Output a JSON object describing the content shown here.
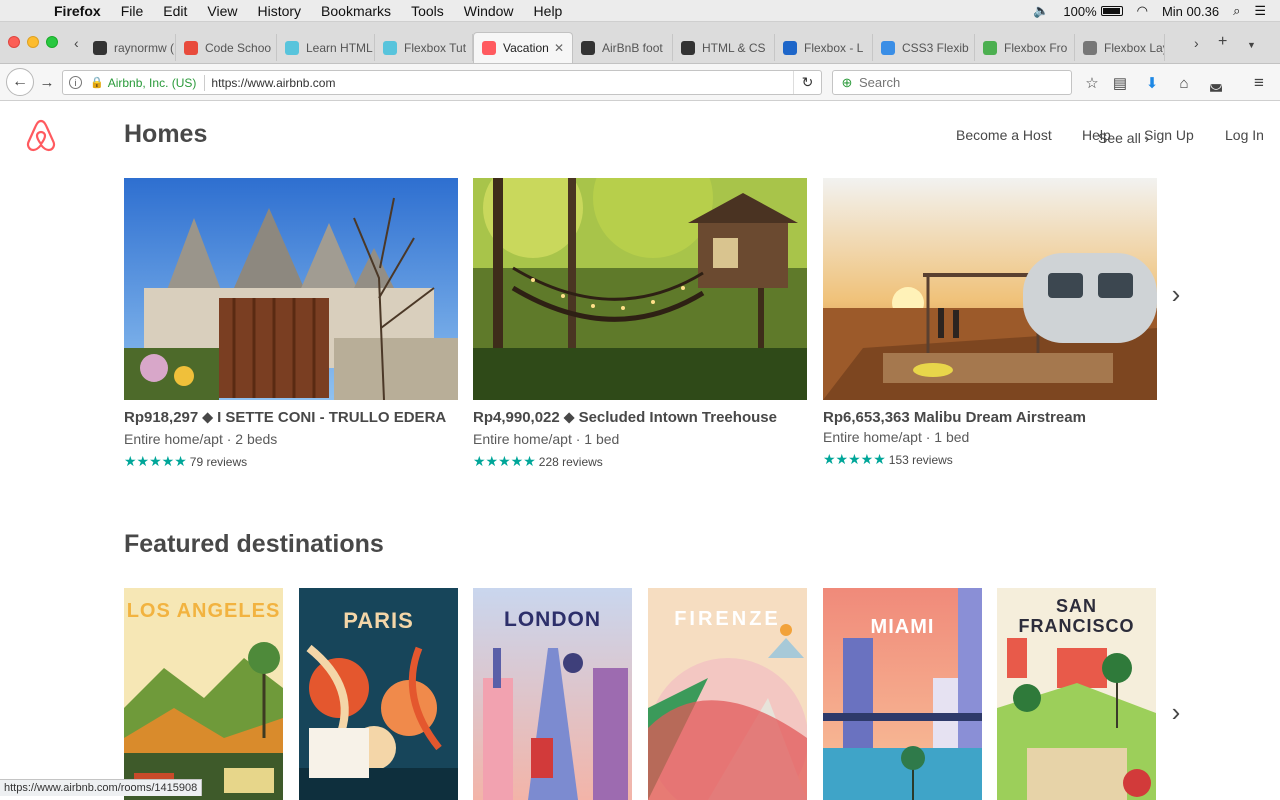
{
  "menubar": {
    "app": "Firefox",
    "items": [
      "File",
      "Edit",
      "View",
      "History",
      "Bookmarks",
      "Tools",
      "Window",
      "Help"
    ],
    "battery": "100%",
    "clock": "Min 00.36"
  },
  "tabs": [
    {
      "label": "raynormw (",
      "color": "#333333"
    },
    {
      "label": "Code Schoo",
      "color": "#e84b3c"
    },
    {
      "label": "Learn HTML",
      "color": "#58c4dc"
    },
    {
      "label": "Flexbox Tut",
      "color": "#58c4dc"
    },
    {
      "label": "Vacation",
      "color": "#ff5a5f",
      "active": true
    },
    {
      "label": "AirBnB foot",
      "color": "#333333"
    },
    {
      "label": "HTML & CS",
      "color": "#333333"
    },
    {
      "label": "Flexbox - L",
      "color": "#1e66c9"
    },
    {
      "label": "CSS3 Flexib",
      "color": "#3a8ee6"
    },
    {
      "label": "Flexbox Fro",
      "color": "#4caf50"
    },
    {
      "label": "Flexbox Lay",
      "color": "#777777"
    }
  ],
  "navbar": {
    "org": "Airbnb, Inc. (US)",
    "url": "https://www.airbnb.com",
    "search_placeholder": "Search"
  },
  "header": {
    "links": [
      "Become a Host",
      "Help",
      "Sign Up",
      "Log In"
    ]
  },
  "homes": {
    "title": "Homes",
    "see_all": "See all",
    "cards": [
      {
        "price": "Rp918,297",
        "name": "I SETTE CONI - TRULLO EDERA",
        "type": "Entire home/apt · 2 beds",
        "reviews": "79 reviews",
        "rating": 5,
        "superhost": true
      },
      {
        "price": "Rp4,990,022",
        "name": "Secluded Intown Treehouse",
        "type": "Entire home/apt · 1 bed",
        "reviews": "228 reviews",
        "rating": 5,
        "superhost": true
      },
      {
        "price": "Rp6,653,363",
        "name": "Malibu Dream Airstream",
        "type": "Entire home/apt · 1 bed",
        "reviews": "153 reviews",
        "rating": 5,
        "superhost": false
      }
    ]
  },
  "featured": {
    "title": "Featured destinations",
    "destinations": [
      "LOS ANGELES",
      "PARIS",
      "LONDON",
      "FIRENZE",
      "MIAMI",
      "SAN FRANCISCO"
    ]
  },
  "status_url": "https://www.airbnb.com/rooms/1415908",
  "colors": {
    "brand": "#ff5a5f",
    "star": "#00a699",
    "text": "#484848"
  }
}
